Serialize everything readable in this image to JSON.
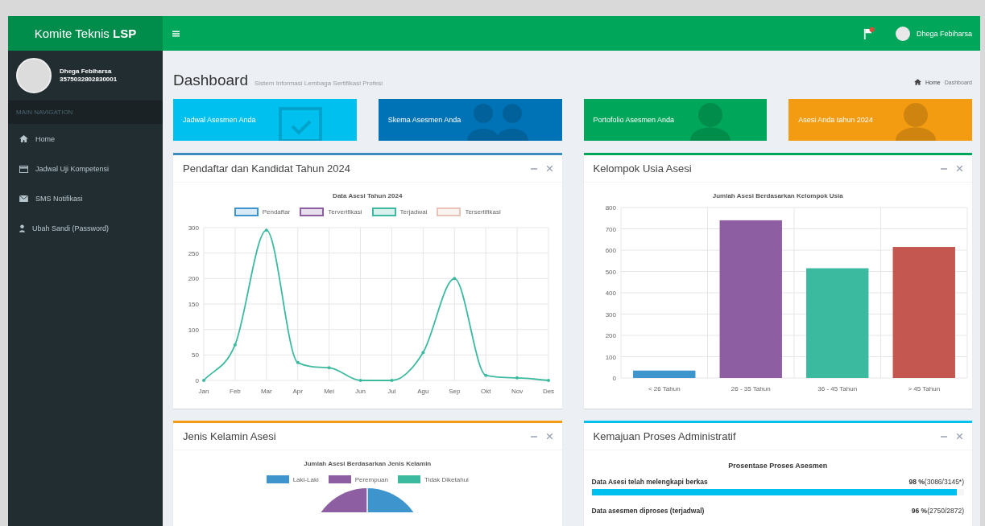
{
  "header": {
    "brand": {
      "text": "Komite Teknis",
      "bold": "LSP"
    },
    "user_name": "Dhega Febiharsa"
  },
  "sidebar": {
    "user": {
      "name": "Dhega Febiharsa",
      "id": "3575032802830001"
    },
    "section": "MAIN NAVIGATION",
    "items": [
      {
        "label": "Home",
        "kind": "home"
      },
      {
        "label": "Jadwal Uji Kompetensi",
        "kind": "calendar"
      },
      {
        "label": "SMS Notifikasi",
        "kind": "envelope"
      },
      {
        "label": "Ubah Sandi (Password)",
        "kind": "user"
      }
    ]
  },
  "page": {
    "title": "Dashboard",
    "subtitle": "Sistem Informasi Lembaga Sertifikasi Profesi",
    "breadcrumb": [
      "Home",
      "Dashboard"
    ]
  },
  "info_boxes": [
    {
      "label": "Jadwal Asesmen Anda",
      "color": "#00c0ef",
      "kind": "calendar"
    },
    {
      "label": "Skema Asesmen Anda",
      "color": "#0073b7",
      "kind": "users"
    },
    {
      "label": "Portofolio Asesmen Anda",
      "color": "#00a65a",
      "kind": "user"
    },
    {
      "label": "Asesi Anda tahun 2024",
      "color": "#f39c12",
      "kind": "user"
    }
  ],
  "registrants_box": {
    "title": "Pendaftar dan Kandidat Tahun 2024",
    "color": "#3c8dbc",
    "chart_data": {
      "type": "line",
      "title": "Data Asesi Tahun 2024",
      "categories": [
        "Jan",
        "Feb",
        "Mar",
        "Apr",
        "Mei",
        "Jun",
        "Jul",
        "Agu",
        "Sep",
        "Okt",
        "Nov",
        "Des"
      ],
      "ylim": [
        0,
        300
      ],
      "yticks": [
        0,
        50,
        100,
        150,
        200,
        250,
        300
      ],
      "grid": true,
      "legend": true,
      "series": [
        {
          "name": "Pendaftar",
          "color": "#3e95cd",
          "values": [
            null,
            null,
            null,
            null,
            null,
            null,
            null,
            null,
            null,
            null,
            null,
            null
          ]
        },
        {
          "name": "Terverifikasi",
          "color": "#8e5ea2",
          "values": [
            null,
            null,
            null,
            null,
            null,
            null,
            null,
            null,
            null,
            null,
            null,
            null
          ]
        },
        {
          "name": "Terjadwal",
          "color": "#3cba9f",
          "values": [
            0,
            70,
            295,
            35,
            25,
            0,
            0,
            55,
            200,
            10,
            5,
            0
          ]
        },
        {
          "name": "Tersertifikasi",
          "color": "#e8c3b9",
          "values": [
            null,
            null,
            null,
            null,
            null,
            null,
            null,
            null,
            null,
            null,
            null,
            null
          ]
        }
      ]
    }
  },
  "age_box": {
    "title": "Kelompok Usia Asesi",
    "color": "#00a65a",
    "chart_data": {
      "type": "bar",
      "title": "Jumlah Asesi Berdasarkan Kelompok Usia",
      "categories": [
        "< 26 Tahun",
        "26 - 35 Tahun",
        "36 - 45 Tahun",
        "> 45 Tahun"
      ],
      "values": [
        35,
        740,
        515,
        615
      ],
      "colors": [
        "#3e95cd",
        "#8e5ea2",
        "#3cba9f",
        "#c45850"
      ],
      "ylim": [
        0,
        800
      ],
      "yticks": [
        0,
        100,
        200,
        300,
        400,
        500,
        600,
        700,
        800
      ],
      "grid": true
    }
  },
  "gender_box": {
    "title": "Jenis Kelamin Asesi",
    "color": "#f39c12",
    "chart_title": "Jumlah Asesi Berdasarkan Jenis Kelamin",
    "legend": [
      {
        "label": "Laki-Laki",
        "color": "#3e95cd"
      },
      {
        "label": "Perempuan",
        "color": "#8e5ea2"
      },
      {
        "label": "Tidak Diketahui",
        "color": "#3cba9f"
      }
    ]
  },
  "progress_box": {
    "title": "Kemajuan Proses Administratif",
    "color": "#00c0ef",
    "heading": "Prosentase Proses Asesmen",
    "rows": [
      {
        "label": "Data Asesi telah melengkapi berkas",
        "percent": "98 %",
        "count": "(3086/3145*)",
        "level": 0.98
      },
      {
        "label": "Data asesmen diproses (terjadwal)",
        "percent": "96 %",
        "count": "(2750/2872)"
      }
    ]
  }
}
